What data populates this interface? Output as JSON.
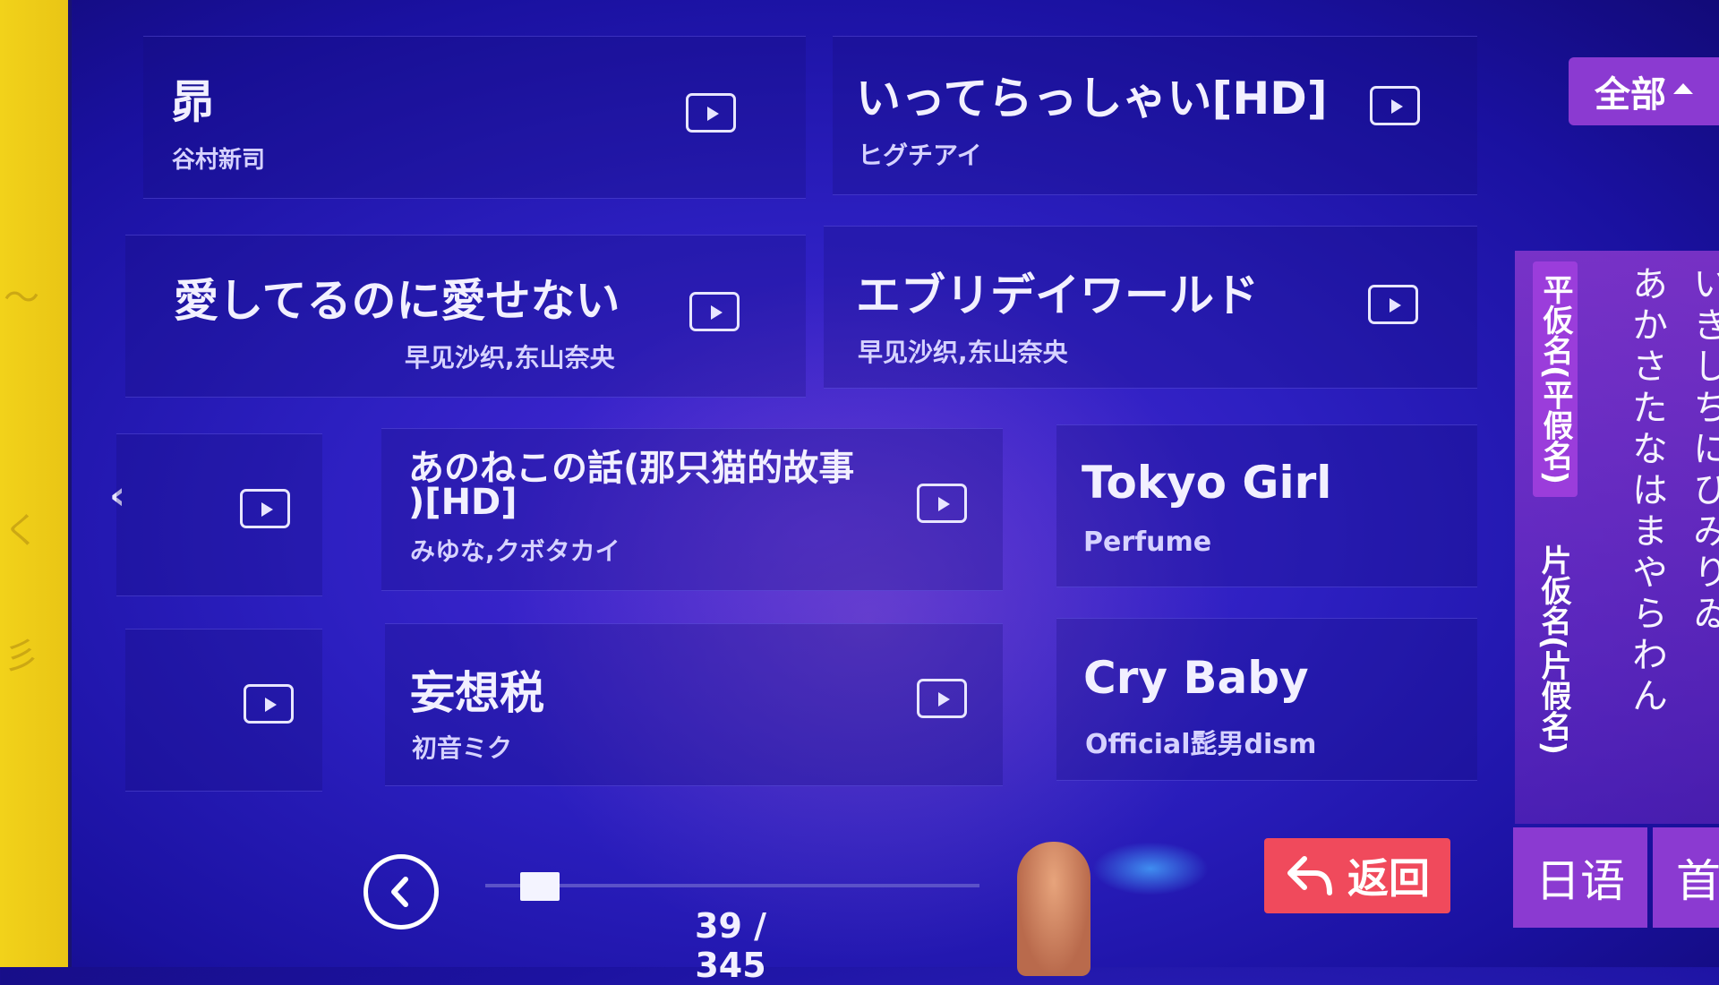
{
  "filter": {
    "label": "全部"
  },
  "songs": [
    {
      "title": "昴",
      "artist": "谷村新司"
    },
    {
      "title": "いってらっしゃい[HD]",
      "artist": "ヒグチアイ"
    },
    {
      "title": "愛してるのに愛せない",
      "artist": "早见沙织,东山奈央"
    },
    {
      "title": "エブリデイワールド",
      "artist": "早见沙织,东山奈央"
    },
    {
      "title_line1": "あのねこの話(那只猫的故事",
      "title_line2": ")[HD]",
      "artist": "みゆな,クボタカイ"
    },
    {
      "title": "Tokyo Girl",
      "artist": "Perfume"
    },
    {
      "title": "妄想税",
      "artist": "初音ミク"
    },
    {
      "title": "Cry Baby",
      "artist": "Official髭男dism"
    }
  ],
  "side_tabs": {
    "hiragana": "平仮名(平假名)",
    "katakana": "片仮名(片假名)"
  },
  "kana_columns": [
    "あかさたなはまやらわん",
    "いきしちにひみりゐ"
  ],
  "pager": {
    "current_total": "39 / 345",
    "progress": 0.11
  },
  "buttons": {
    "back": "返回",
    "language": "日语",
    "home": "首"
  },
  "colors": {
    "accent_purple": "#8b3ad1",
    "back_red": "#f04a5c",
    "background": "#2c1fc0"
  }
}
